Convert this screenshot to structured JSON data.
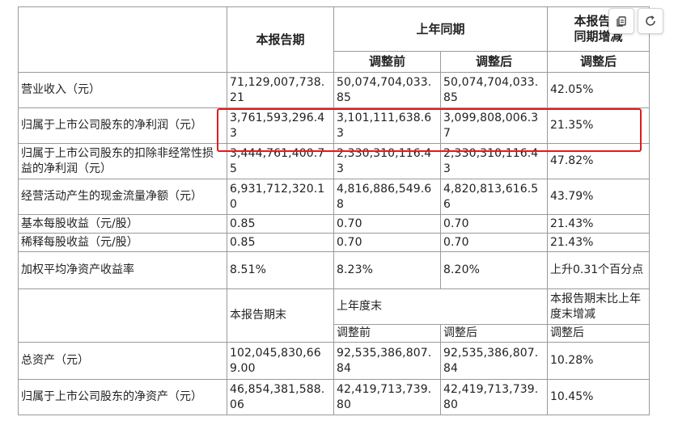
{
  "headers": {
    "current_period": "本报告期",
    "prior_year_same_period": "上年同期",
    "yoy_change_line1": "本报告期",
    "yoy_change_line2": "同期增减",
    "before_adjustment": "调整前",
    "after_adjustment": "调整后",
    "adjusted": "调整后"
  },
  "rows_top": [
    {
      "label": "营业收入（元）",
      "current": "71,129,007,738.21",
      "before": "50,074,704,033.85",
      "after": "50,074,704,033.85",
      "change": "42.05%"
    },
    {
      "label": "归属于上市公司股东的净利润（元）",
      "current": "3,761,593,296.43",
      "before": "3,101,111,638.63",
      "after": "3,099,808,006.37",
      "change": "21.35%"
    },
    {
      "label": "归属于上市公司股东的扣除非经常性损 益的净利润（元）",
      "current": "3,444,761,400.75",
      "before": "2,330,310,116.43",
      "after": "2,330,310,116.43",
      "change": "47.82%"
    },
    {
      "label": "经营活动产生的现金流量净额（元）",
      "current": "6,931,712,320.10",
      "before": "4,816,886,549.68",
      "after": "4,820,813,616.56",
      "change": "43.79%"
    },
    {
      "label": "基本每股收益（元/股）",
      "current": "0.85",
      "before": "0.70",
      "after": "0.70",
      "change": "21.43%"
    },
    {
      "label": "稀释每股收益（元/股）",
      "current": "0.85",
      "before": "0.70",
      "after": "0.70",
      "change": "21.43%"
    },
    {
      "label": "加权平均净资产收益率",
      "current": "8.51%",
      "before": "8.23%",
      "after": "8.20%",
      "change": "上升0.31个百分点"
    }
  ],
  "headers_bottom": {
    "period_end": "本报告期末",
    "prior_year_end": "上年度末",
    "change_vs_year_end": "本报告期末比上年度末增减",
    "before_adjustment": "调整前",
    "after_adjustment": "调整后",
    "adjusted": "调整后"
  },
  "rows_bottom": [
    {
      "label": "总资产（元）",
      "current": "102,045,830,669.00",
      "before": "92,535,386,807.84",
      "after": "92,535,386,807.84",
      "change": "10.28%"
    },
    {
      "label": "归属于上市公司股东的净资产（元）",
      "current": "46,854,381,588.06",
      "before": "42,419,713,739.80",
      "after": "42,419,713,739.80",
      "change": "10.45%"
    }
  ],
  "toolbar": {
    "copy_icon": "copy-icon",
    "refresh_icon": "refresh-icon"
  },
  "colors": {
    "highlight": "#e01b1b",
    "border": "#9a9a9a"
  }
}
